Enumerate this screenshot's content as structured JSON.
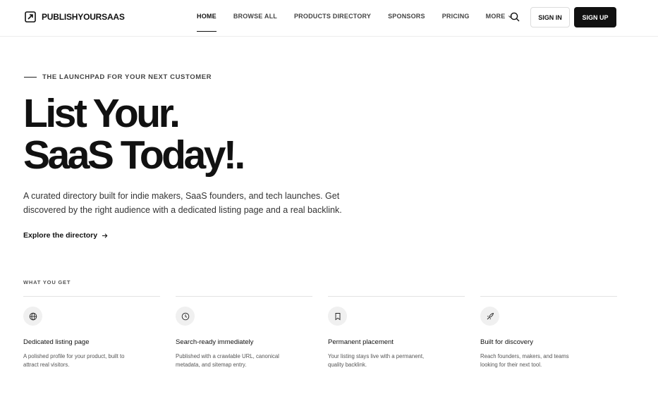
{
  "header": {
    "logo_text": "PUBLISHYOURSAAS",
    "nav": [
      {
        "label": "HOME"
      },
      {
        "label": "BROWSE ALL"
      },
      {
        "label": "PRODUCTS DIRECTORY"
      },
      {
        "label": "SPONSORS"
      },
      {
        "label": "PRICING"
      },
      {
        "label": "MORE"
      }
    ],
    "signin_label": "SIGN IN",
    "signup_label": "SIGN UP"
  },
  "hero": {
    "eyebrow": "THE LAUNCHPAD FOR YOUR NEXT CUSTOMER",
    "title_line1": "List Your.",
    "title_line2": "SaaS Today!.",
    "description": "A curated directory built for indie makers, SaaS founders, and tech launches. Get discovered by the right audience with a dedicated listing page and a real backlink.",
    "cta_label": "Explore the directory"
  },
  "what_you_get": {
    "label": "WHAT YOU GET",
    "features": [
      {
        "icon": "globe-icon",
        "title": "Dedicated listing page",
        "desc": "A polished profile for your product, built to attract real visitors."
      },
      {
        "icon": "clock-icon",
        "title": "Search-ready immediately",
        "desc": "Published with a crawlable URL, canonical metadata, and sitemap entry."
      },
      {
        "icon": "bookmark-icon",
        "title": "Permanent placement",
        "desc": "Your listing stays live with a permanent, quality backlink."
      },
      {
        "icon": "rocket-icon",
        "title": "Built for discovery",
        "desc": "Reach founders, makers, and teams looking for their next tool."
      }
    ]
  },
  "colors": {
    "primary": "#111111",
    "border": "#e3e3e3",
    "icon_bg": "#f0f0f0"
  }
}
